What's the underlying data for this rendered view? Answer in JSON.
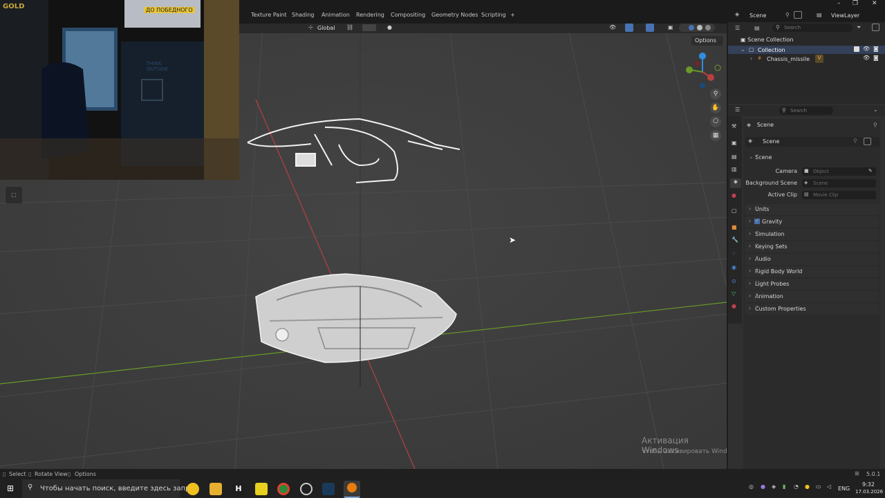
{
  "workspace_tabs": [
    "Texture Paint",
    "Shading",
    "Animation",
    "Rendering",
    "Compositing",
    "Geometry Nodes",
    "Scripting",
    "+"
  ],
  "header": {
    "scene_label": "Scene",
    "viewlayer_label": "ViewLayer",
    "transform_orientation": "Global",
    "options_label": "Options"
  },
  "outliner": {
    "search_placeholder": "Search",
    "root": "Scene Collection",
    "collection": "Collection",
    "object": "Chassis_missile"
  },
  "properties": {
    "search_placeholder": "Search",
    "context": "Scene",
    "breadcrumb": "Scene",
    "panel_title": "Scene",
    "camera_label": "Camera",
    "camera_placeholder": "Object",
    "background_label": "Background Scene",
    "background_placeholder": "Scene",
    "clip_label": "Active Clip",
    "clip_placeholder": "Movie Clip",
    "sections": [
      "Units",
      "Gravity",
      "Simulation",
      "Keying Sets",
      "Audio",
      "Rigid Body World",
      "Light Probes",
      "Animation",
      "Custom Properties"
    ]
  },
  "watermark": {
    "line1": "Активация Windows",
    "line2": "Чтобы активировать Windows, перейдите в раздел \"Параметры\"."
  },
  "webcam": {
    "sign_top": "GOLD",
    "sign_banner": "ДО ПОБЕДНОГО",
    "booth_text": "THINK OUTSIDE"
  },
  "statusbar": {
    "select": "Select",
    "rotate": "Rotate View",
    "options": "Options",
    "version": "5.0.1"
  },
  "taskbar": {
    "search_placeholder": "Чтобы начать поиск, введите здесь запрос",
    "lang": "ENG",
    "time": "9:32",
    "date": "17.03.2026"
  },
  "colors": {
    "accent": "#4772b3",
    "x_axis": "#b8403f",
    "y_axis": "#6a9a26",
    "gizmo_z": "#2f8fe0"
  }
}
